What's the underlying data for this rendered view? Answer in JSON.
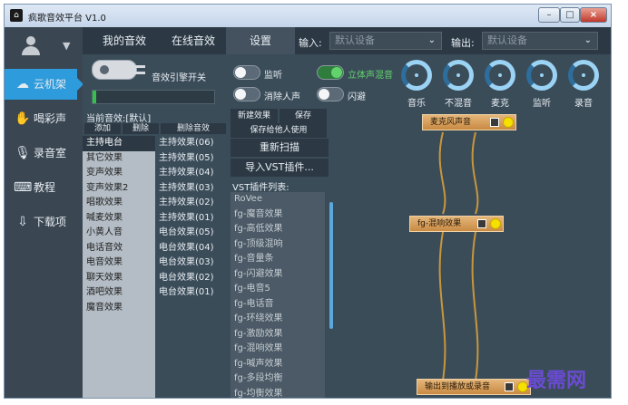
{
  "window": {
    "title": "疯歌音效平台 V1.0",
    "min_label": "–",
    "max_label": "□",
    "close_label": "×",
    "app_icon": "house-icon"
  },
  "sidebar": {
    "avatar_icon": "user-icon",
    "caret": "▼",
    "items": [
      {
        "label": "云机架",
        "icon": "cloud-icon",
        "glyph": "☁"
      },
      {
        "label": "喝彩声",
        "icon": "clap-icon",
        "glyph": "✋"
      },
      {
        "label": "录音室",
        "icon": "mic-icon",
        "glyph": "🎙"
      },
      {
        "label": "教程",
        "icon": "tutorial-icon",
        "glyph": "⌨"
      },
      {
        "label": "下载项",
        "icon": "cloud-download-icon",
        "glyph": "⇩"
      }
    ]
  },
  "nav": {
    "tabs": [
      "我的音效",
      "在线音效",
      "设置"
    ],
    "input_label": "输入:",
    "input_value": "默认设备",
    "output_label": "输出:",
    "output_value": "默认设备",
    "caret": "⌄"
  },
  "controls": {
    "engine_label": "音效引擎开关",
    "engine_level": 0.03,
    "toggles": [
      {
        "label": "监听",
        "on": false
      },
      {
        "label": "消除人声",
        "on": false
      },
      {
        "label": "立体声混音",
        "on": true
      },
      {
        "label": "闪避",
        "on": false
      }
    ],
    "knobs": [
      "音乐",
      "不混音",
      "麦克",
      "监听",
      "录音"
    ],
    "accent": "#2e9bdc",
    "on_color": "#62d26c"
  },
  "effects": {
    "current_label": "当前音效:[默认]",
    "add_label": "添加",
    "delete_label": "删除",
    "delete_fx_label": "删除音效",
    "list1": [
      "主持电台",
      "其它效果",
      "变声效果",
      "变声效果2",
      "唱歌效果",
      "喊麦效果",
      "小黄人音",
      "电话音效",
      "电音效果",
      "聊天效果",
      "酒吧效果",
      "魔音效果"
    ],
    "list2": [
      "主持效果(06)",
      "主持效果(05)",
      "主持效果(04)",
      "主持效果(03)",
      "主持效果(02)",
      "主持效果(01)",
      "电台效果(05)",
      "电台效果(04)",
      "电台效果(03)",
      "电台效果(02)",
      "电台效果(01)"
    ]
  },
  "vst": {
    "new_fx_label": "新建效果",
    "save_label": "保存",
    "save_for_others_label": "保存给他人使用",
    "rescan_label": "重新扫描",
    "import_label": "导入VST插件...",
    "list_title": "VST插件列表:",
    "plugins": [
      "RoVee",
      "fg-魔音效果",
      "fg-高低效果",
      "fg-顶级混响",
      "fg-音量条",
      "fg-闪避效果",
      "fg-电音5",
      "fg-电话音",
      "fg-环绕效果",
      "fg-激励效果",
      "fg-混响效果",
      "fg-喊声效果",
      "fg-多段均衡",
      "fg-均衡效果"
    ]
  },
  "graph": {
    "nodes": [
      {
        "label": "麦克风声音"
      },
      {
        "label": "fg-混响效果"
      },
      {
        "label": "输出到播放或录音"
      }
    ],
    "wire_color": "#c8963c"
  },
  "watermark": "最需网"
}
